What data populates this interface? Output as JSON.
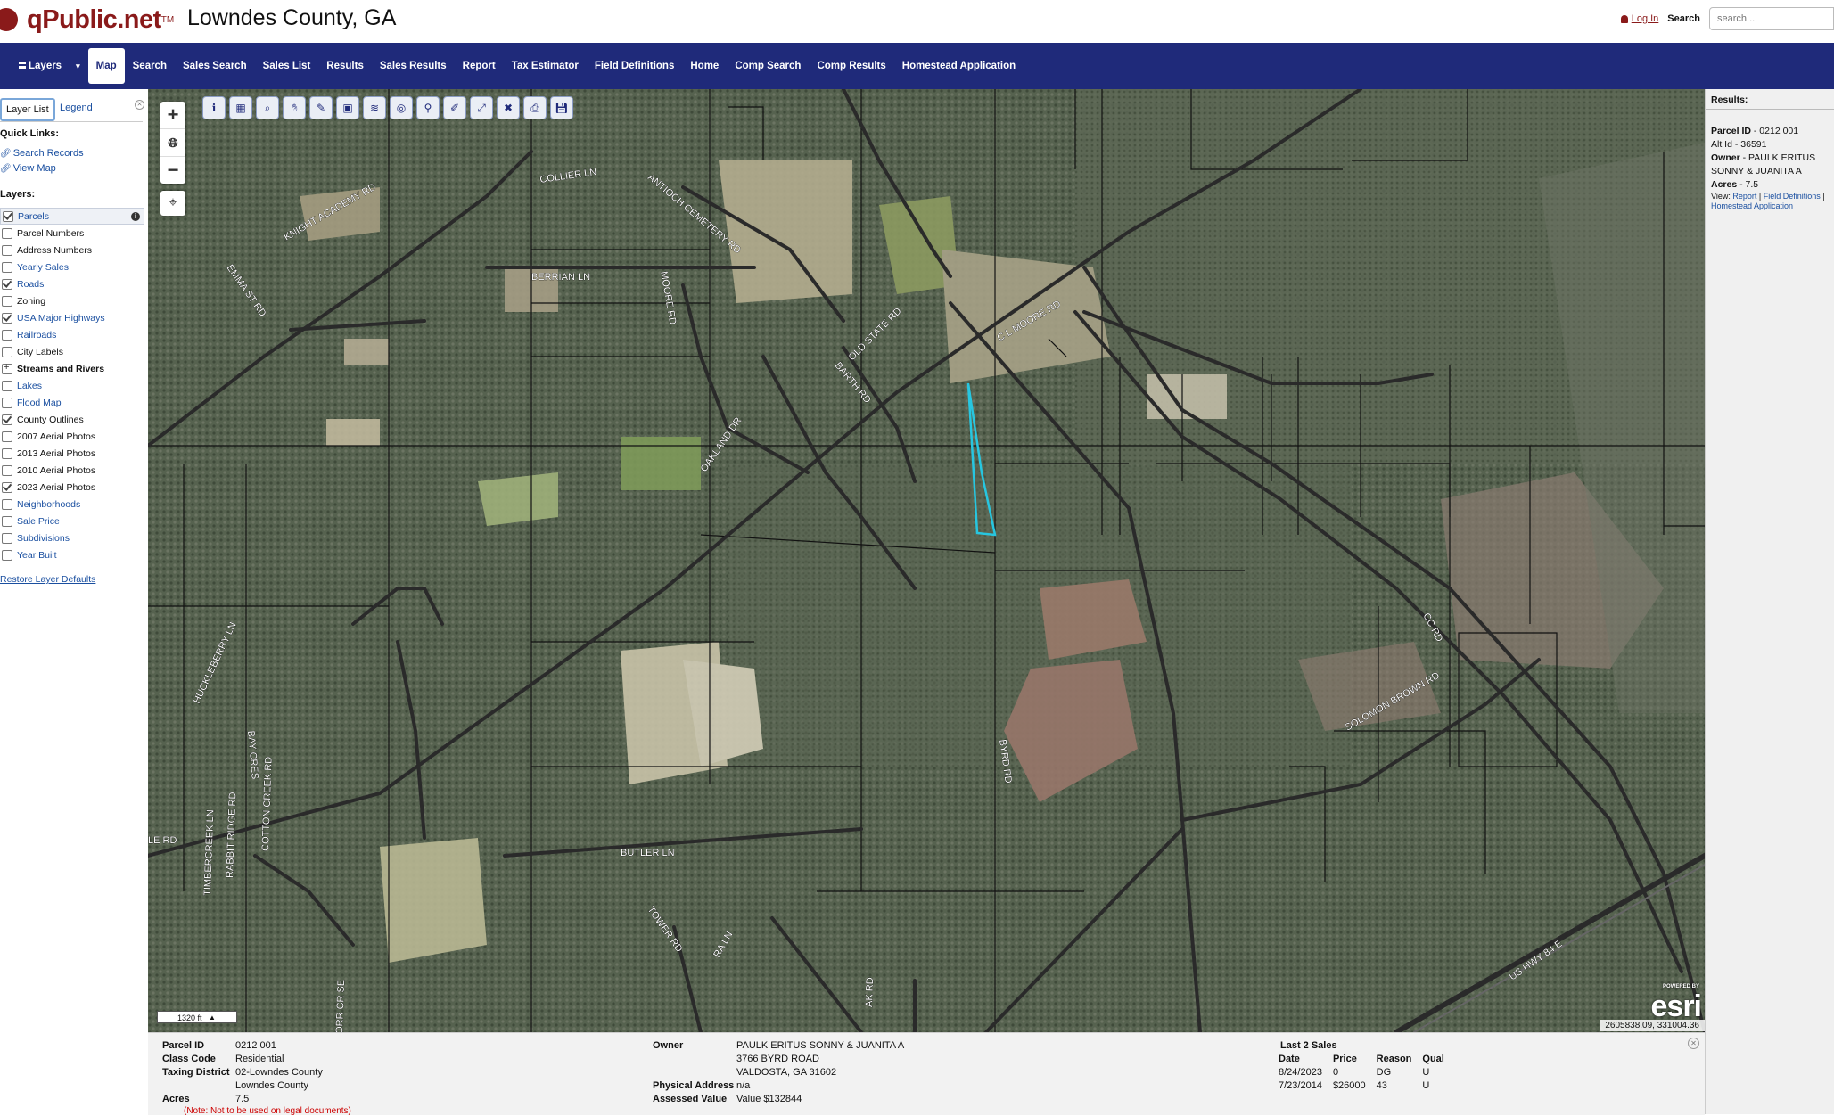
{
  "header": {
    "brand": "qPublic.net",
    "trademark": "TM",
    "county": "Lowndes County, GA",
    "login": "Log In",
    "search_label": "Search",
    "search_placeholder": "search..."
  },
  "nav": {
    "items": [
      "Layers",
      "Map",
      "Search",
      "Sales Search",
      "Sales List",
      "Results",
      "Sales Results",
      "Report",
      "Tax Estimator",
      "Field Definitions",
      "Home",
      "Comp Search",
      "Comp Results",
      "Homestead Application"
    ],
    "active": "Map"
  },
  "left_panel": {
    "tabs": [
      "Layer List",
      "Legend"
    ],
    "quick_links_title": "Quick Links:",
    "quick_links": [
      "Search Records",
      "View Map"
    ],
    "layers_title": "Layers:",
    "layers": [
      {
        "name": "Parcels",
        "checked": true,
        "style": "link",
        "selected": true,
        "info": true
      },
      {
        "name": "Parcel Numbers",
        "checked": false,
        "style": "plain"
      },
      {
        "name": "Address Numbers",
        "checked": false,
        "style": "plain"
      },
      {
        "name": "Yearly Sales",
        "checked": false,
        "style": "link"
      },
      {
        "name": "Roads",
        "checked": true,
        "style": "link"
      },
      {
        "name": "Zoning",
        "checked": false,
        "style": "plain"
      },
      {
        "name": "USA Major Highways",
        "checked": true,
        "style": "link"
      },
      {
        "name": "Railroads",
        "checked": false,
        "style": "link"
      },
      {
        "name": "City Labels",
        "checked": false,
        "style": "plain"
      },
      {
        "name": "Streams and Rivers",
        "checked": false,
        "style": "bold",
        "expandable": true
      },
      {
        "name": "Lakes",
        "checked": false,
        "style": "link"
      },
      {
        "name": "Flood Map",
        "checked": false,
        "style": "link"
      },
      {
        "name": "County Outlines",
        "checked": true,
        "style": "plain"
      },
      {
        "name": "2007 Aerial Photos",
        "checked": false,
        "style": "plain"
      },
      {
        "name": "2013 Aerial Photos",
        "checked": false,
        "style": "plain"
      },
      {
        "name": "2010 Aerial Photos",
        "checked": false,
        "style": "plain"
      },
      {
        "name": "2023 Aerial Photos",
        "checked": true,
        "style": "plain"
      },
      {
        "name": "Neighborhoods",
        "checked": false,
        "style": "link"
      },
      {
        "name": "Sale Price",
        "checked": false,
        "style": "link"
      },
      {
        "name": "Subdivisions",
        "checked": false,
        "style": "link"
      },
      {
        "name": "Year Built",
        "checked": false,
        "style": "link"
      }
    ],
    "restore": "Restore Layer Defaults"
  },
  "map": {
    "toolbar_icons": [
      "identify-icon",
      "select-icon",
      "query-icon",
      "pan-icon",
      "erase-icon",
      "select-box-icon",
      "layers-icon",
      "buffer-icon",
      "find-icon",
      "measure-icon",
      "zoom-extent-icon",
      "clear-icon",
      "print-icon",
      "save-icon"
    ],
    "road_labels": [
      "COLLIER LN",
      "ANTIOCH CEMETERY RD",
      "KNIGHT ACADEMY RD",
      "EMMA ST RD",
      "BERRIAN LN",
      "MOORE RD",
      "OLD STATE RD",
      "C L MOORE RD",
      "BARTH RD",
      "OAKLAND DR",
      "BYRD RD",
      "SOLOMON BROWN RD",
      "CC RD",
      "BUTLER LN",
      "TOWER RD",
      "ORR CR SE",
      "US HWY 84 E",
      "TIMBERCREEK LN",
      "RABBIT RIDGE RD",
      "COTTON CREEK RD",
      "HUCKLEBERRY LN",
      "AK RD",
      "RA LN",
      "LE RD",
      "BAY CRES"
    ],
    "scale": "1320 ft",
    "esri_powered": "POWERED BY",
    "esri_logo": "esri",
    "coordinates": "2605838.09, 331004.36"
  },
  "results": {
    "title": "Results:",
    "parcel_id_label": "Parcel ID",
    "parcel_id": "0212 001",
    "alt_id_label": "Alt Id",
    "alt_id": "36591",
    "owner_label": "Owner",
    "owner": "PAULK ERITUS SONNY & JUANITA A",
    "acres_label": "Acres",
    "acres": "7.5",
    "view_label": "View:",
    "view_links": [
      "Report",
      "Field Definitions",
      "Homestead Application"
    ]
  },
  "detail": {
    "parcel_id_label": "Parcel ID",
    "parcel_id": "0212 001",
    "class_code_label": "Class Code",
    "class_code": "Residential",
    "taxing_district_label": "Taxing District",
    "taxing_district": "02-Lowndes County",
    "taxing_district_2": "Lowndes County",
    "acres_label": "Acres",
    "acres": "7.5",
    "owner_label": "Owner",
    "owner_name": "PAULK ERITUS SONNY & JUANITA A",
    "owner_address1": "3766 BYRD ROAD",
    "owner_address2": "VALDOSTA, GA 31602",
    "physical_address_label": "Physical Address",
    "physical_address": "n/a",
    "assessed_value_label": "Assessed Value",
    "assessed_value": "Value $132844",
    "sales_title": "Last 2 Sales",
    "sales_headers": [
      "Date",
      "Price",
      "Reason",
      "Qual"
    ],
    "sales": [
      [
        "8/24/2023",
        "0",
        "DG",
        "U"
      ],
      [
        "7/23/2014",
        "$26000",
        "43",
        "U"
      ]
    ],
    "note": "(Note: Not to be used on legal documents)"
  },
  "colors": {
    "nav_bg": "#1f2a7a",
    "brand": "#8a1a1a",
    "parcel_highlight": "#27c6e0"
  }
}
